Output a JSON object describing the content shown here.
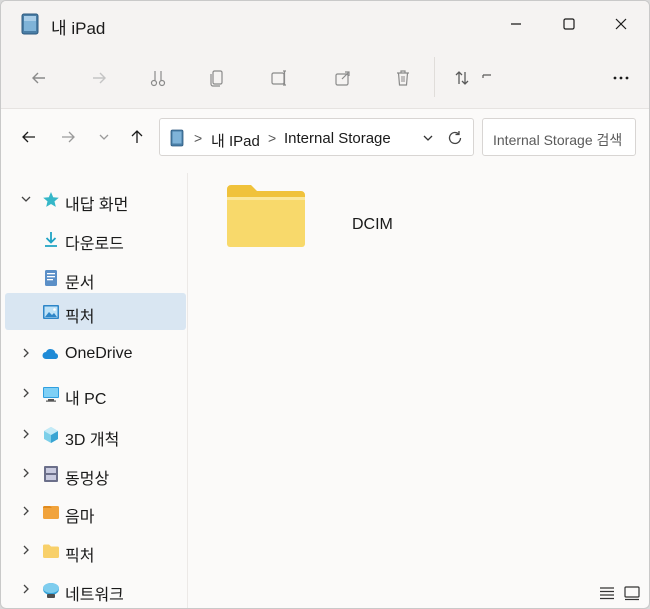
{
  "window": {
    "title": "내 iPad",
    "controls": {
      "minimize": "minimize",
      "maximize": "maximize",
      "close": "close"
    }
  },
  "toolbar": {
    "icons": [
      "back-arrow-icon",
      "forward-arrow-icon",
      "cut-icon",
      "copy-icon",
      "rename-icon",
      "share-icon",
      "delete-icon",
      "sort-icon",
      "view-icon",
      "more-icon"
    ],
    "more_label": "···"
  },
  "navigation": {
    "breadcrumb": [
      "내 IPad",
      "Internal Storage"
    ],
    "search_placeholder": "Internal Storage 검색"
  },
  "sidebar": {
    "items": [
      {
        "label": "내답 화먼",
        "icon": "star-icon",
        "expandable": true,
        "selected": false
      },
      {
        "label": "다운로드",
        "icon": "download-icon",
        "expandable": false,
        "selected": false
      },
      {
        "label": "문서",
        "icon": "document-icon",
        "expandable": false,
        "selected": false
      },
      {
        "label": "픽처",
        "icon": "picture-icon",
        "expandable": false,
        "selected": true
      },
      {
        "label": "OneDrive",
        "icon": "cloud-icon",
        "expandable": true,
        "selected": false
      },
      {
        "label": "내 PC",
        "icon": "pc-icon",
        "expandable": true,
        "selected": false
      },
      {
        "label": "3D 개척",
        "icon": "cube-icon",
        "expandable": true,
        "selected": false
      },
      {
        "label": "동멍상",
        "icon": "video-icon",
        "expandable": true,
        "selected": false
      },
      {
        "label": "음마",
        "icon": "music-icon",
        "expandable": true,
        "selected": false
      },
      {
        "label": "픽처",
        "icon": "folder-icon",
        "expandable": true,
        "selected": false
      },
      {
        "label": "네트워크",
        "icon": "network-icon",
        "expandable": true,
        "selected": false
      }
    ]
  },
  "content": {
    "items": [
      {
        "name": "DCIM",
        "type": "folder"
      }
    ]
  },
  "colors": {
    "accent": "#0067c0",
    "folder": "#f8d96b",
    "selected_bg": "#d9e6f2"
  }
}
